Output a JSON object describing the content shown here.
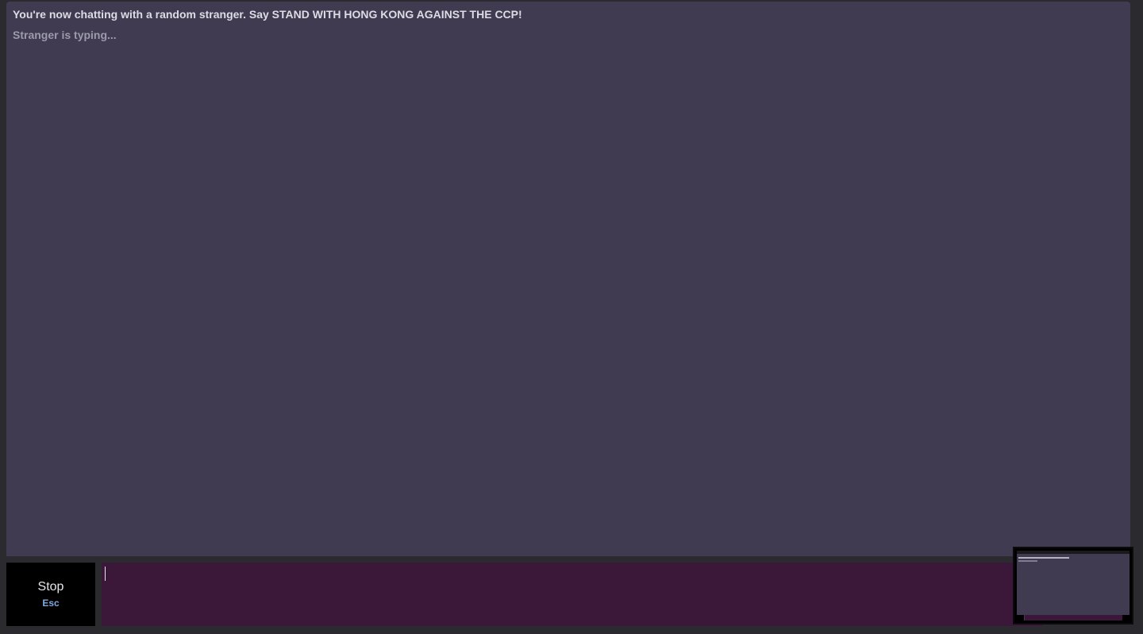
{
  "chat": {
    "status_message": "You're now chatting with a random stranger. Say STAND WITH HONG KONG AGAINST THE CCP!",
    "typing_indicator": "Stranger is typing..."
  },
  "controls": {
    "stop_label": "Stop",
    "stop_hint": "Esc",
    "message_value": ""
  },
  "colors": {
    "chat_background": "#403b51",
    "input_background": "#3b173a",
    "stop_background": "#000000",
    "hint_color": "#7fa9dd"
  }
}
